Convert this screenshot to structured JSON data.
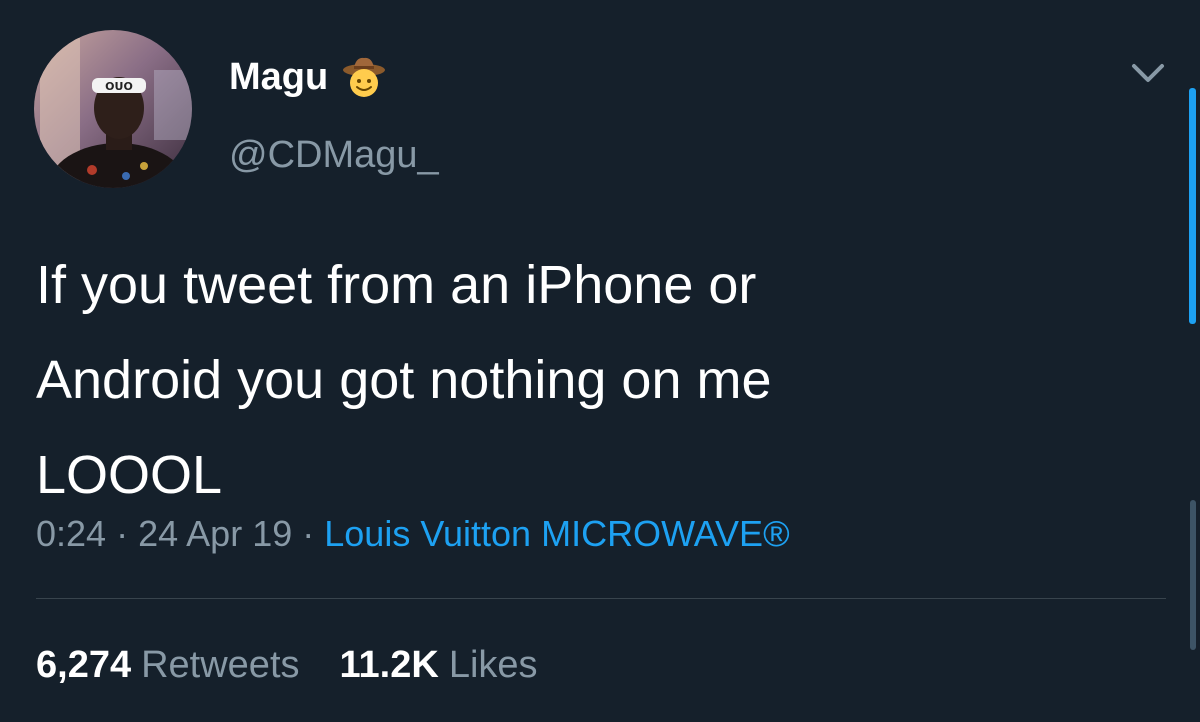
{
  "user": {
    "display_name": "Magu",
    "handle": "@CDMagu_",
    "badge_emoji": "cowboy-hat-face-icon"
  },
  "tweet": {
    "text": "If you tweet from an iPhone or\nAndroid you got nothing on me\nLOOOL",
    "time": "0:24",
    "separator": "·",
    "date": "24 Apr 19",
    "source": "Louis Vuitton MICROWAVE®"
  },
  "stats": {
    "retweets_count": "6,274",
    "retweets_label": "Retweets",
    "likes_count": "11.2K",
    "likes_label": "Likes"
  },
  "colors": {
    "background": "#15202b",
    "primary_text": "#ffffff",
    "secondary_text": "#8899a6",
    "accent": "#1da1f2",
    "divider": "#38444d"
  },
  "icons": {
    "menu": "chevron-down-icon"
  }
}
